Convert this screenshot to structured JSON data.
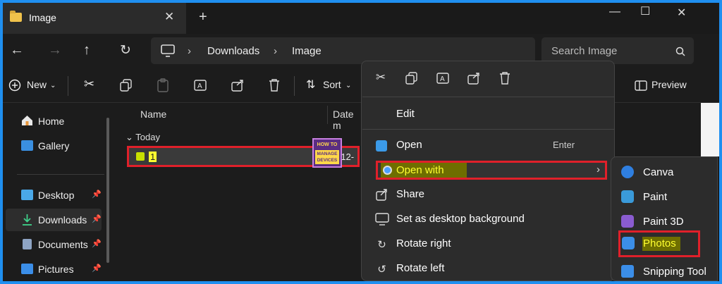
{
  "window": {
    "tab_title": "Image",
    "new_tab_symbol": "+",
    "close_symbol": "✕",
    "minimize_symbol": "—",
    "maximize_symbol": "☐",
    "window_close_symbol": "✕"
  },
  "nav": {
    "breadcrumbs": [
      "Downloads",
      "Image"
    ],
    "search_placeholder": "Search Image"
  },
  "commandbar": {
    "new_label": "New",
    "sort_label": "Sort",
    "preview_label": "Preview"
  },
  "sidebar": {
    "items": [
      {
        "label": "Home",
        "icon": "home-icon"
      },
      {
        "label": "Gallery",
        "icon": "gallery-icon"
      },
      {
        "label": "Desktop",
        "icon": "desktop-icon",
        "pinned": true
      },
      {
        "label": "Downloads",
        "icon": "downloads-icon",
        "pinned": true,
        "active": true
      },
      {
        "label": "Documents",
        "icon": "documents-icon",
        "pinned": true
      },
      {
        "label": "Pictures",
        "icon": "pictures-icon",
        "pinned": true
      }
    ]
  },
  "filelist": {
    "columns": [
      "Name",
      "Date m"
    ],
    "group": "Today",
    "files": [
      {
        "name": "1",
        "date": "-12-"
      }
    ]
  },
  "logo": {
    "line1": "HOW TO",
    "line2": "MANAGE",
    "line3": "DEVICES"
  },
  "context_menu": {
    "items": [
      {
        "label": "Edit"
      },
      {
        "label": "Open",
        "shortcut": "Enter"
      },
      {
        "label": "Open with",
        "highlighted": true
      },
      {
        "label": "Share"
      },
      {
        "label": "Set as desktop background"
      },
      {
        "label": "Rotate right"
      },
      {
        "label": "Rotate left"
      }
    ]
  },
  "open_with_submenu": {
    "items": [
      {
        "label": "Canva",
        "color": "#2f7fe0"
      },
      {
        "label": "Paint",
        "color": "#3a9ad9"
      },
      {
        "label": "Paint 3D",
        "color": "#8a5cd0"
      },
      {
        "label": "Photos",
        "color": "#3b8ee8",
        "highlighted": true
      },
      {
        "label": "Snipping Tool",
        "color": "#3b8ee8"
      }
    ]
  },
  "colors": {
    "highlight_border": "#e0202a",
    "highlight_text": "#ffff30",
    "frame_border": "#1f8ff0"
  }
}
